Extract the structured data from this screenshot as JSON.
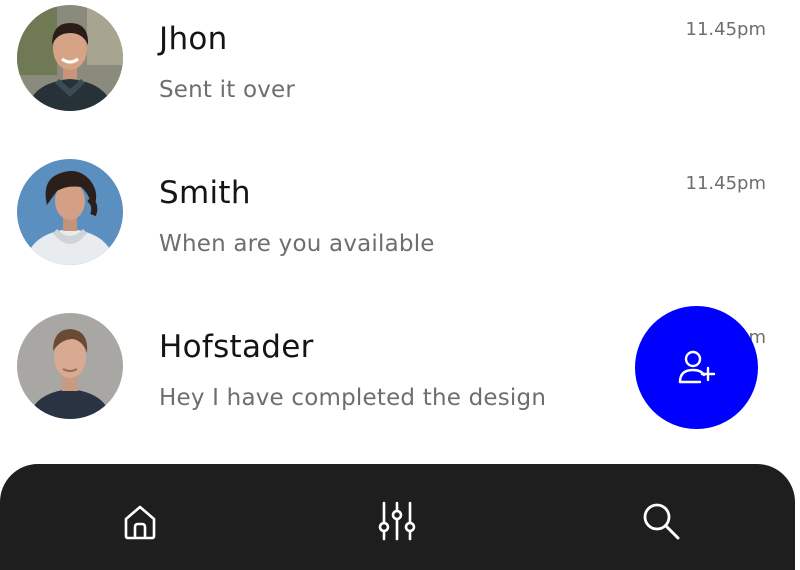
{
  "chats": [
    {
      "name": "Jhon",
      "message": "Sent it over",
      "time": "11.45pm"
    },
    {
      "name": "Smith",
      "message": "When are you available",
      "time": "11.45pm"
    },
    {
      "name": "Hofstader",
      "message": "Hey I have completed the design",
      "time": "11.45pm"
    }
  ],
  "fab": {
    "icon": "add-user-icon"
  },
  "bottom_nav": {
    "items": [
      {
        "icon": "home-icon"
      },
      {
        "icon": "sliders-icon"
      },
      {
        "icon": "search-icon"
      }
    ]
  },
  "colors": {
    "accent": "#0000ff",
    "nav_background": "#1e1e1e",
    "name_text": "#141414",
    "secondary_text": "#6e6e6e"
  }
}
